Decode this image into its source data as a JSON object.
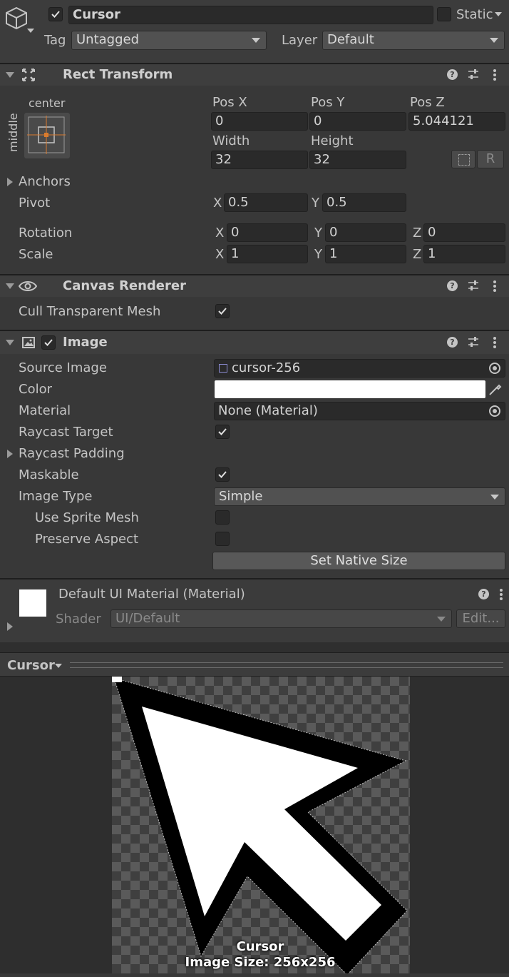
{
  "header": {
    "object_name": "Cursor",
    "active": true,
    "static_label": "Static",
    "tag_label": "Tag",
    "tag_value": "Untagged",
    "layer_label": "Layer",
    "layer_value": "Default"
  },
  "rect_transform": {
    "title": "Rect Transform",
    "anchor_preset_h": "center",
    "anchor_preset_v": "middle",
    "pos_x_label": "Pos X",
    "pos_y_label": "Pos Y",
    "pos_z_label": "Pos Z",
    "pos_x": "0",
    "pos_y": "0",
    "pos_z": "5.044121",
    "width_label": "Width",
    "height_label": "Height",
    "width": "32",
    "height": "32",
    "raw_button": "R",
    "anchors_label": "Anchors",
    "pivot_label": "Pivot",
    "pivot_x": "0.5",
    "pivot_y": "0.5",
    "rotation_label": "Rotation",
    "rotation": {
      "x": "0",
      "y": "0",
      "z": "0"
    },
    "scale_label": "Scale",
    "scale": {
      "x": "1",
      "y": "1",
      "z": "1"
    },
    "axis_x": "X",
    "axis_y": "Y",
    "axis_z": "Z"
  },
  "canvas_renderer": {
    "title": "Canvas Renderer",
    "cull_label": "Cull Transparent Mesh",
    "cull_checked": true
  },
  "image": {
    "title": "Image",
    "enabled": true,
    "source_image_label": "Source Image",
    "source_image_value": "cursor-256",
    "color_label": "Color",
    "color_value": "#ffffff",
    "material_label": "Material",
    "material_value": "None (Material)",
    "raycast_target_label": "Raycast Target",
    "raycast_target": true,
    "raycast_padding_label": "Raycast Padding",
    "maskable_label": "Maskable",
    "maskable": true,
    "image_type_label": "Image Type",
    "image_type_value": "Simple",
    "use_sprite_mesh_label": "Use Sprite Mesh",
    "use_sprite_mesh": false,
    "preserve_aspect_label": "Preserve Aspect",
    "preserve_aspect": false,
    "set_native_size_label": "Set Native Size"
  },
  "material": {
    "title": "Default UI Material (Material)",
    "shader_label": "Shader",
    "shader_value": "UI/Default",
    "edit_label": "Edit..."
  },
  "preview": {
    "dropdown_label": "Cursor",
    "caption_name": "Cursor",
    "caption_size": "Image Size: 256x256"
  },
  "icons": {
    "gameobject": "cube-icon",
    "rect": "rect-transform-icon",
    "eye": "eye-icon",
    "image": "image-component-icon",
    "help": "help-icon",
    "settings": "sliders-icon",
    "menu": "kebab-menu-icon",
    "picker": "eyedropper-icon",
    "target": "object-picker-icon"
  },
  "colors": {
    "panel_bg": "#383838",
    "header_bg": "#3e3e3e",
    "field_bg": "#2a2a2a",
    "anchor_accent": "#d97b2d"
  }
}
